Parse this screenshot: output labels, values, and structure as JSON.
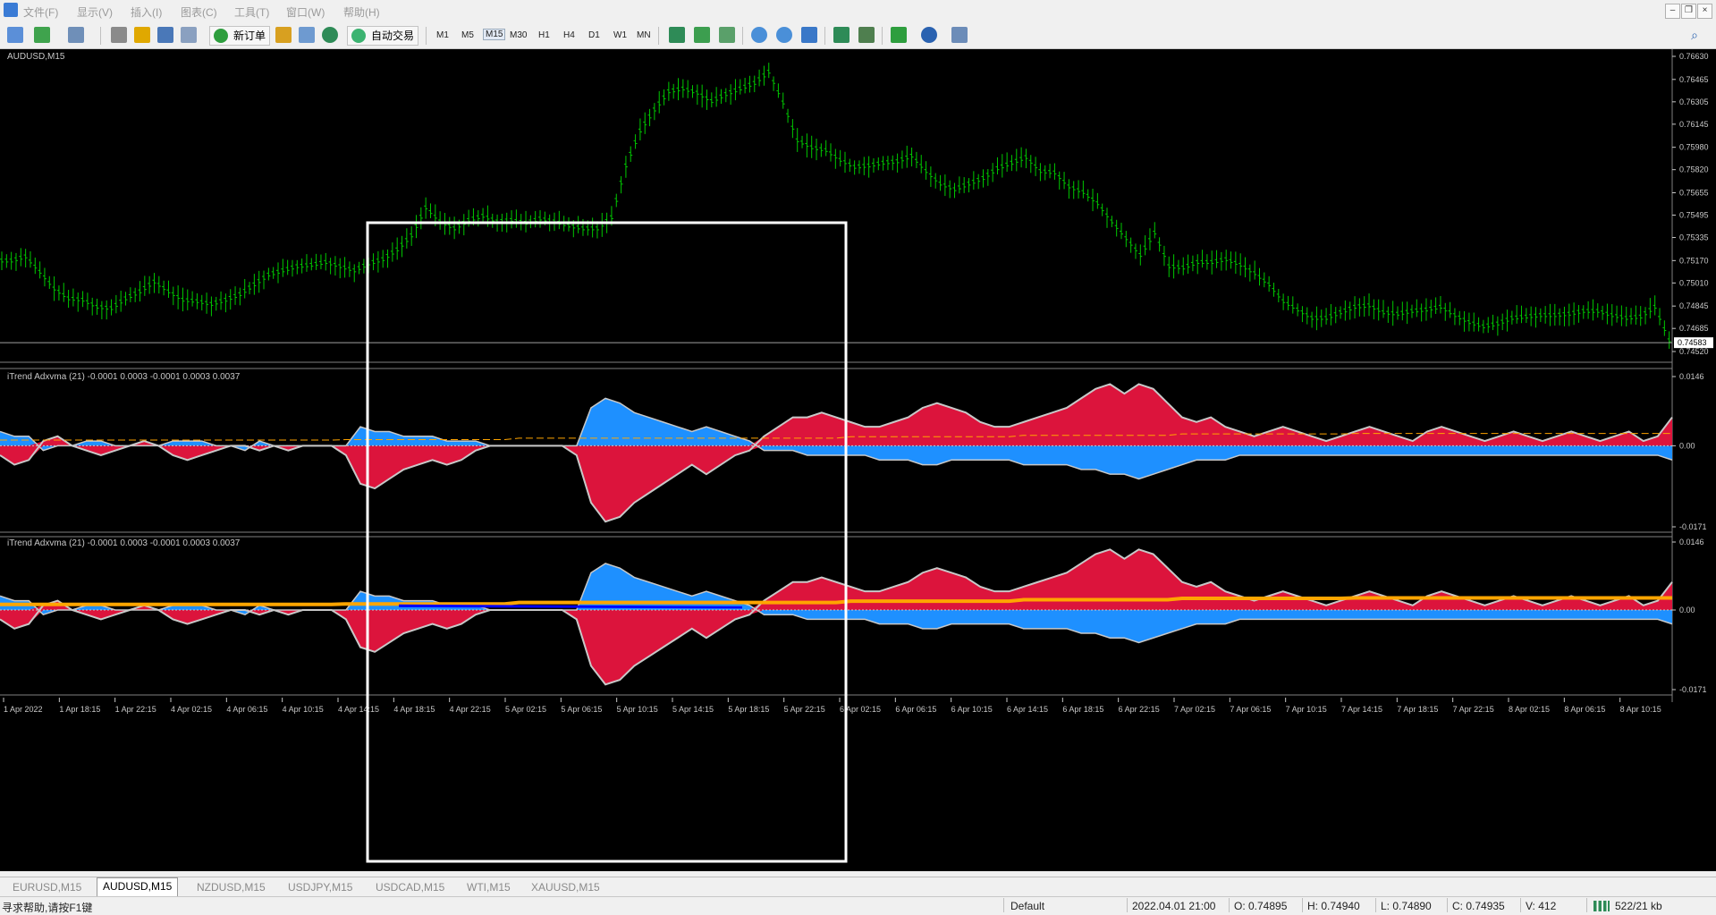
{
  "menu": [
    "文件(F)",
    "显示(V)",
    "插入(I)",
    "图表(C)",
    "工具(T)",
    "窗口(W)",
    "帮助(H)"
  ],
  "toolbar": {
    "new_order": "新订单",
    "auto_trade": "自动交易",
    "timeframes": [
      "M1",
      "M5",
      "M15",
      "M30",
      "H1",
      "H4",
      "D1",
      "W1",
      "MN"
    ],
    "selected_timeframe": "M15"
  },
  "chart": {
    "symbol_label": "AUDUSD,M15",
    "price_axis": [
      "0.76630",
      "0.76465",
      "0.76305",
      "0.76145",
      "0.75980",
      "0.75820",
      "0.75655",
      "0.75495",
      "0.75335",
      "0.75170",
      "0.75010",
      "0.74845",
      "0.74685",
      "0.74520"
    ],
    "current_price": "0.74583",
    "indicator_label": "iTrend Adxvma (21) -0.0001 0.0003 -0.0001 0.0003 0.0037",
    "indicator_axis": [
      "0.0146",
      "0.00",
      "-0.0171"
    ],
    "time_axis": [
      "1 Apr 2022",
      "1 Apr 18:15",
      "1 Apr 22:15",
      "4 Apr 02:15",
      "4 Apr 06:15",
      "4 Apr 10:15",
      "4 Apr 14:15",
      "4 Apr 18:15",
      "4 Apr 22:15",
      "5 Apr 02:15",
      "5 Apr 06:15",
      "5 Apr 10:15",
      "5 Apr 14:15",
      "5 Apr 18:15",
      "5 Apr 22:15",
      "6 Apr 02:15",
      "6 Apr 06:15",
      "6 Apr 10:15",
      "6 Apr 14:15",
      "6 Apr 18:15",
      "6 Apr 22:15",
      "7 Apr 02:15",
      "7 Apr 06:15",
      "7 Apr 10:15",
      "7 Apr 14:15",
      "7 Apr 18:15",
      "7 Apr 22:15",
      "8 Apr 02:15",
      "8 Apr 06:15",
      "8 Apr 10:15"
    ],
    "colors": {
      "bars": "#00c800",
      "bull": "#dc143c",
      "bear": "#1e90ff",
      "signal": "#ffa500",
      "highlight": "#0000ff"
    },
    "price_series": [
      0.7517,
      0.752,
      0.7509,
      0.7497,
      0.749,
      0.7489,
      0.7484,
      0.7483,
      0.749,
      0.7495,
      0.7502,
      0.7495,
      0.7489,
      0.7488,
      0.7486,
      0.7489,
      0.7493,
      0.75,
      0.7507,
      0.751,
      0.7513,
      0.7514,
      0.7516,
      0.7513,
      0.751,
      0.7515,
      0.7518,
      0.7525,
      0.7535,
      0.7555,
      0.7545,
      0.754,
      0.7546,
      0.7549,
      0.7545,
      0.7546,
      0.7544,
      0.7547,
      0.7545,
      0.7542,
      0.754,
      0.754,
      0.7548,
      0.7585,
      0.761,
      0.7625,
      0.7638,
      0.764,
      0.7637,
      0.7631,
      0.7636,
      0.764,
      0.7644,
      0.7652,
      0.763,
      0.7603,
      0.7598,
      0.7596,
      0.7589,
      0.7584,
      0.7585,
      0.7587,
      0.7588,
      0.7592,
      0.7581,
      0.7572,
      0.7568,
      0.7572,
      0.7576,
      0.7583,
      0.7587,
      0.7591,
      0.7581,
      0.758,
      0.757,
      0.7566,
      0.7558,
      0.7545,
      0.7533,
      0.7521,
      0.7537,
      0.7513,
      0.7512,
      0.7516,
      0.7516,
      0.7518,
      0.7514,
      0.7508,
      0.75,
      0.7488,
      0.7482,
      0.7476,
      0.7476,
      0.748,
      0.7484,
      0.7485,
      0.748,
      0.7479,
      0.7481,
      0.7482,
      0.7484,
      0.7478,
      0.7473,
      0.747,
      0.7472,
      0.7476,
      0.7477,
      0.7478,
      0.7478,
      0.7479,
      0.7481,
      0.7481,
      0.7478,
      0.7476,
      0.7477,
      0.7484,
      0.746
    ],
    "osc_series": [
      -0.002,
      -0.004,
      -0.003,
      0.001,
      0.002,
      0.0,
      -0.001,
      -0.002,
      -0.001,
      0.0,
      0.001,
      0.0,
      -0.002,
      -0.003,
      -0.002,
      -0.001,
      0.0,
      0.0,
      -0.001,
      0.0,
      -0.001,
      0.0,
      0.0,
      0.0,
      -0.002,
      -0.008,
      -0.009,
      -0.007,
      -0.005,
      -0.004,
      -0.003,
      -0.004,
      -0.003,
      -0.001,
      0.0,
      0.0,
      0.0,
      0.0,
      0.0,
      0.0,
      -0.002,
      -0.012,
      -0.016,
      -0.015,
      -0.012,
      -0.01,
      -0.008,
      -0.006,
      -0.004,
      -0.006,
      -0.004,
      -0.002,
      -0.001,
      0.002,
      0.004,
      0.006,
      0.006,
      0.007,
      0.006,
      0.005,
      0.004,
      0.004,
      0.005,
      0.006,
      0.008,
      0.009,
      0.008,
      0.007,
      0.005,
      0.004,
      0.004,
      0.005,
      0.006,
      0.007,
      0.008,
      0.01,
      0.012,
      0.013,
      0.011,
      0.013,
      0.012,
      0.009,
      0.006,
      0.005,
      0.006,
      0.004,
      0.003,
      0.002,
      0.003,
      0.004,
      0.003,
      0.002,
      0.001,
      0.002,
      0.003,
      0.004,
      0.003,
      0.002,
      0.001,
      0.003,
      0.004,
      0.003,
      0.002,
      0.001,
      0.002,
      0.003,
      0.002,
      0.001,
      0.002,
      0.003,
      0.002,
      0.001,
      0.002,
      0.003,
      0.001,
      0.002,
      0.006
    ],
    "osc_bear_series": [
      0.003,
      0.002,
      0.002,
      0.001,
      0.0,
      0.0,
      0.001,
      0.001,
      0.0,
      0.0,
      0.0,
      0.0,
      0.001,
      0.001,
      0.001,
      0.0,
      0.0,
      0.001,
      0.001,
      0.0,
      0.0,
      0.0,
      0.0,
      0.0,
      0.0,
      0.004,
      0.003,
      0.003,
      0.002,
      0.002,
      0.002,
      0.001,
      0.001,
      0.001,
      0.0,
      0.0,
      0.0,
      0.0,
      0.0,
      0.0,
      0.0,
      0.008,
      0.01,
      0.009,
      0.007,
      0.006,
      0.005,
      0.004,
      0.003,
      0.004,
      0.003,
      0.002,
      0.001,
      0.001,
      0.001,
      0.001,
      0.002,
      0.002,
      0.002,
      0.002,
      0.002,
      0.003,
      0.003,
      0.003,
      0.004,
      0.004,
      0.003,
      0.003,
      0.003,
      0.003,
      0.003,
      0.004,
      0.004,
      0.004,
      0.004,
      0.005,
      0.005,
      0.006,
      0.006,
      0.007,
      0.006,
      0.005,
      0.004,
      0.003,
      0.003,
      0.003,
      0.002,
      0.002,
      0.002,
      0.002,
      0.002,
      0.002,
      0.002,
      0.002,
      0.002,
      0.002,
      0.002,
      0.002,
      0.002,
      0.002,
      0.002,
      0.002,
      0.002,
      0.002,
      0.002,
      0.002,
      0.002,
      0.002,
      0.002,
      0.002,
      0.002,
      0.002,
      0.002,
      0.002,
      0.002,
      0.002,
      0.003
    ]
  },
  "tabs": [
    "EURUSD,M15",
    "AUDUSD,M15",
    "NZDUSD,M15",
    "USDJPY,M15",
    "USDCAD,M15",
    "WTI,M15",
    "XAUUSD,M15"
  ],
  "active_tab": "AUDUSD,M15",
  "status": {
    "help": "寻求帮助,请按F1键",
    "profile": "Default",
    "datetime": "2022.04.01 21:00",
    "open": "O: 0.74895",
    "high": "H: 0.74940",
    "low": "L: 0.74890",
    "close": "C: 0.74935",
    "volume": "V: 412",
    "traffic": "522/21 kb"
  }
}
